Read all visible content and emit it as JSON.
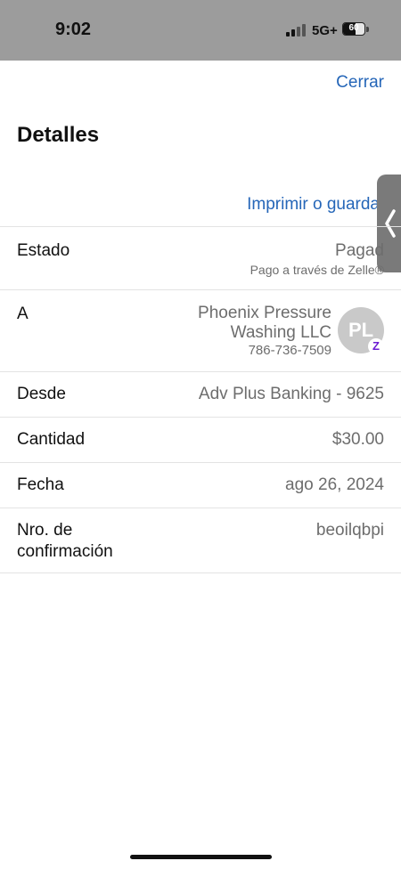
{
  "status_bar": {
    "time": "9:02",
    "network": "5G+",
    "battery": "60"
  },
  "sheet": {
    "close_label": "Cerrar",
    "title": "Detalles",
    "print_label": "Imprimir o guarda",
    "side_handle_icon": "chevron-left-icon"
  },
  "details": {
    "status": {
      "label": "Estado",
      "value": "Pagad",
      "sub": "Pago a través de Zelle®"
    },
    "to": {
      "label": "A",
      "name": "Phoenix Pressure Washing LLC",
      "phone": "786-736-7509",
      "avatar_initials": "PL",
      "badge": "Z",
      "badge_color": "#6c1cd3"
    },
    "from": {
      "label": "Desde",
      "value": "Adv Plus Banking - 9625"
    },
    "amount": {
      "label": "Cantidad",
      "value": "$30.00"
    },
    "date": {
      "label": "Fecha",
      "value": "ago 26, 2024"
    },
    "confirmation": {
      "label": "Nro. de confirmación",
      "value": "beoilqbpi"
    }
  },
  "colors": {
    "accent": "#2566b8",
    "status_bar": "#9c9c9c"
  }
}
